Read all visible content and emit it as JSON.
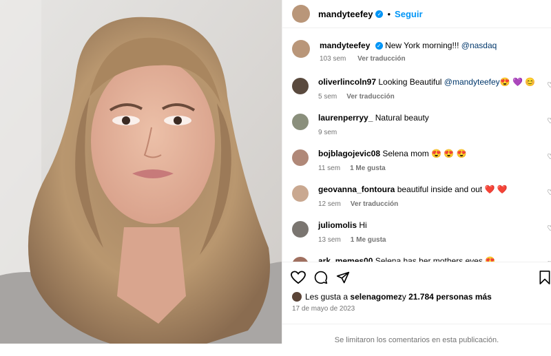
{
  "post": {
    "username": "mandyteefey",
    "verified_glyph": "✓",
    "separator": "•",
    "follow_label": "Seguir",
    "caption_user": "mandyteefey",
    "caption_text": "New York morning!!! ",
    "caption_mention": "@nasdaq",
    "caption_time": "103 sem",
    "caption_translate": "Ver traducción"
  },
  "comments": [
    {
      "user": "oliverlincoln97",
      "text": "Looking Beautiful ",
      "mention": "@mandyteefey",
      "emoji": "😍 💜 😊",
      "time": "5 sem",
      "action": "Ver traducción",
      "avatar_color": "#5a4a3e"
    },
    {
      "user": "laurenperryy_",
      "text": "Natural beauty",
      "mention": "",
      "emoji": "",
      "time": "9 sem",
      "action": "",
      "avatar_color": "#8a8f7c"
    },
    {
      "user": "bojblagojevic08",
      "text": "Selena mom ",
      "mention": "",
      "emoji": "😍 😍 😍",
      "time": "11 sem",
      "action": "1 Me gusta",
      "avatar_color": "#b08878"
    },
    {
      "user": "geovanna_fontoura",
      "text": "beautiful inside and out ",
      "mention": "",
      "emoji": "❤️ ❤️",
      "time": "12 sem",
      "action": "Ver traducción",
      "avatar_color": "#c9a890"
    },
    {
      "user": "juliomolis",
      "text": "Hi",
      "mention": "",
      "emoji": "",
      "time": "13 sem",
      "action": "1 Me gusta",
      "avatar_color": "#7a7570"
    },
    {
      "user": "ark_memes00",
      "text": "Selena has her mothers eyes ",
      "mention": "",
      "emoji": "😍",
      "time": "",
      "action": "",
      "avatar_color": "#a07060"
    }
  ],
  "icons": {
    "heart": "heart-icon",
    "comment": "comment-icon",
    "share": "share-icon",
    "save": "bookmark-icon",
    "like_small": "small-heart-icon"
  },
  "likes": {
    "prefix": "Les gusta a ",
    "user": "selenagomez",
    "middle": " y ",
    "count": "21.784 personas más"
  },
  "date": "17 de mayo de 2023",
  "comments_limited": "Se limitaron los comentarios en esta publicación.",
  "colors": {
    "accent": "#0095f6",
    "mention": "#00376b",
    "muted": "#737373"
  }
}
